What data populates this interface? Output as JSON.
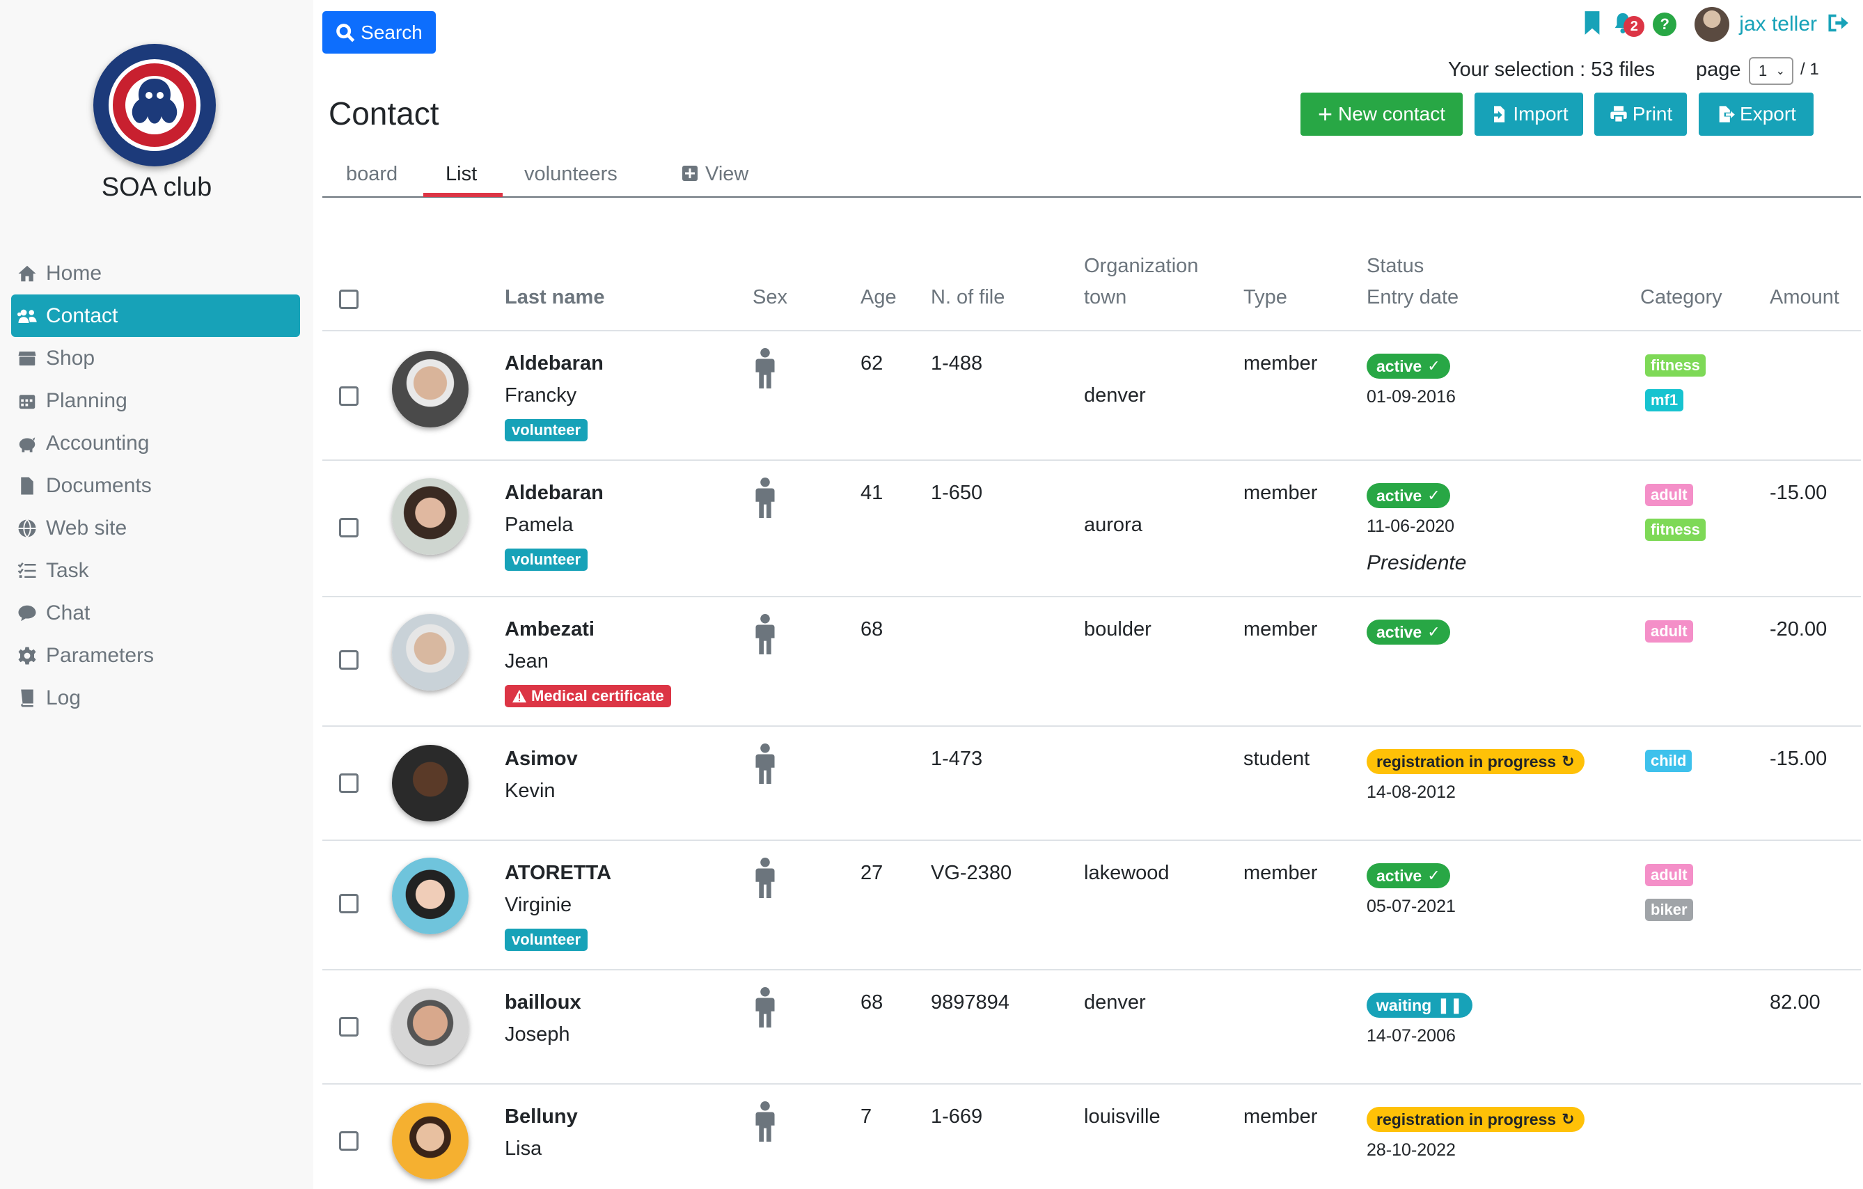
{
  "app": {
    "club_name": "SOA club"
  },
  "sidebar": {
    "items": [
      {
        "label": "Home",
        "icon": "home-icon"
      },
      {
        "label": "Contact",
        "icon": "users-icon",
        "active": true
      },
      {
        "label": "Shop",
        "icon": "store-icon"
      },
      {
        "label": "Planning",
        "icon": "calendar-icon"
      },
      {
        "label": "Accounting",
        "icon": "piggy-bank-icon"
      },
      {
        "label": "Documents",
        "icon": "file-icon"
      },
      {
        "label": "Web site",
        "icon": "globe-icon"
      },
      {
        "label": "Task",
        "icon": "task-list-icon"
      },
      {
        "label": "Chat",
        "icon": "chat-bubble-icon"
      },
      {
        "label": "Parameters",
        "icon": "gear-icon"
      },
      {
        "label": "Log",
        "icon": "book-icon"
      }
    ]
  },
  "header": {
    "search_label": "Search",
    "notification_count": "2",
    "help_label": "?",
    "user_name": "jax teller",
    "selection_text": "Your selection : 53 files",
    "page_label": "page",
    "page_value": "1",
    "page_total": "/ 1"
  },
  "main": {
    "title": "Contact",
    "actions": {
      "new_contact": "New contact",
      "import": "Import",
      "print": "Print",
      "export": "Export"
    },
    "tabs": [
      "board",
      "List",
      "volunteers",
      "View"
    ],
    "active_tab": "List"
  },
  "table": {
    "headers": {
      "last_name": "Last name",
      "sex": "Sex",
      "age": "Age",
      "file": "N. of file",
      "org_line1": "Organization",
      "org_line2": "town",
      "type": "Type",
      "status_line1": "Status",
      "status_line2": "Entry date",
      "category": "Category",
      "amount": "Amount"
    },
    "rows": [
      {
        "last": "Aldebaran",
        "first": "Francky",
        "tag": "volunteer",
        "age": "62",
        "file": "1-488",
        "town": "denver",
        "type": "member",
        "status": "active",
        "date": "01-09-2016",
        "role": "",
        "cats": [
          "fitness",
          "mf1"
        ],
        "amount": ""
      },
      {
        "last": "Aldebaran",
        "first": "Pamela",
        "tag": "volunteer",
        "age": "41",
        "file": "1-650",
        "town": "aurora",
        "type": "member",
        "status": "active",
        "date": "11-06-2020",
        "role": "Presidente",
        "cats": [
          "adult",
          "fitness"
        ],
        "amount": "-15.00"
      },
      {
        "last": "Ambezati",
        "first": "Jean",
        "tag": "Medical certificate",
        "age": "68",
        "file": "",
        "town": "boulder",
        "type": "member",
        "status": "active",
        "date": "",
        "role": "",
        "cats": [
          "adult"
        ],
        "amount": "-20.00"
      },
      {
        "last": "Asimov",
        "first": "Kevin",
        "tag": "",
        "age": "",
        "file": "1-473",
        "town": "",
        "type": "student",
        "status": "registration in progress",
        "date": "14-08-2012",
        "role": "",
        "cats": [
          "child"
        ],
        "amount": "-15.00"
      },
      {
        "last": "ATORETTA",
        "first": "Virginie",
        "tag": "volunteer",
        "age": "27",
        "file": "VG-2380",
        "town": "lakewood",
        "type": "member",
        "status": "active",
        "date": "05-07-2021",
        "role": "",
        "cats": [
          "adult",
          "biker"
        ],
        "amount": ""
      },
      {
        "last": "bailloux",
        "first": "Joseph",
        "tag": "",
        "age": "68",
        "file": "9897894",
        "town": "denver",
        "type": "",
        "status": "waiting",
        "date": "14-07-2006",
        "role": "",
        "cats": [],
        "amount": "82.00"
      },
      {
        "last": "Belluny",
        "first": "Lisa",
        "tag": "",
        "age": "7",
        "file": "1-669",
        "town": "louisville",
        "type": "member",
        "status": "registration in progress",
        "date": "28-10-2022",
        "role": "",
        "cats": [],
        "amount": ""
      }
    ]
  },
  "colors": {
    "accent": "#17a2b8",
    "success": "#28a745",
    "warning": "#ffc107",
    "danger": "#dc3545",
    "primary": "#0d6efd",
    "cat_fitness": "#7ed957",
    "cat_mf1": "#17c3d0",
    "cat_adult": "#f48fc8",
    "cat_child": "#3ec1ec",
    "cat_biker": "#a0a4a8"
  }
}
